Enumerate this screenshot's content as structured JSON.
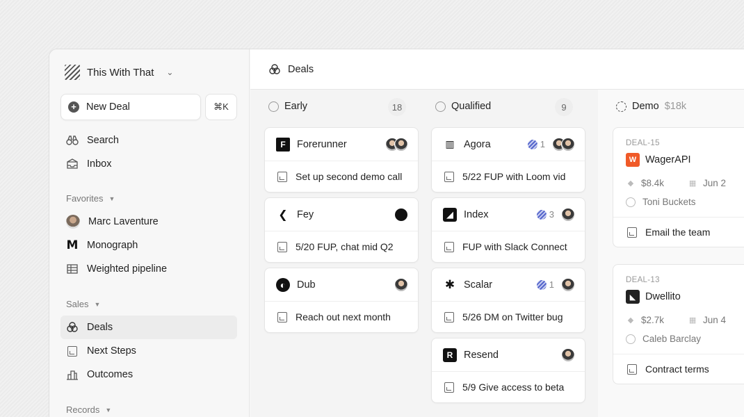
{
  "workspace": {
    "name": "This With That"
  },
  "sidebar": {
    "new_deal_label": "New Deal",
    "shortcut": "⌘K",
    "top_items": [
      {
        "label": "Search",
        "icon": "binoculars-icon"
      },
      {
        "label": "Inbox",
        "icon": "inbox-icon"
      }
    ],
    "favorites_header": "Favorites",
    "favorites": [
      {
        "label": "Marc Laventure",
        "icon": "avatar"
      },
      {
        "label": "Monograph",
        "icon": "monograph-logo-icon"
      },
      {
        "label": "Weighted pipeline",
        "icon": "table-icon"
      }
    ],
    "sales_header": "Sales",
    "sales": [
      {
        "label": "Deals",
        "icon": "deals-icon",
        "active": true
      },
      {
        "label": "Next Steps",
        "icon": "chart-doc-icon"
      },
      {
        "label": "Outcomes",
        "icon": "building-icon"
      }
    ],
    "records_header": "Records"
  },
  "topbar": {
    "title": "Deals"
  },
  "columns": [
    {
      "name": "Early",
      "count": "18",
      "cards": [
        {
          "company": "Forerunner",
          "task": "Set up second demo call",
          "logo_color": "#111111",
          "logo_char": "F"
        },
        {
          "company": "Fey",
          "task": "5/20 FUP, chat mid Q2",
          "logo_color": "#ffffff",
          "logo_char": "❮"
        },
        {
          "company": "Dub",
          "task": "Reach out next month",
          "logo_color": "#111111",
          "logo_char": "◐"
        }
      ]
    },
    {
      "name": "Qualified",
      "count": "9",
      "cards": [
        {
          "company": "Agora",
          "task": "5/22 FUP with Loom vid",
          "badge": "1",
          "logo_color": "#ffffff",
          "logo_char": "▥"
        },
        {
          "company": "Index",
          "task": "FUP with Slack Connect",
          "badge": "3",
          "logo_color": "#111111",
          "logo_char": "◢"
        },
        {
          "company": "Scalar",
          "task": "5/26 DM on Twitter bug",
          "badge": "1",
          "logo_color": "#ffffff",
          "logo_char": "✱"
        },
        {
          "company": "Resend",
          "task": "5/9 Give access to beta",
          "logo_color": "#111111",
          "logo_char": "R"
        }
      ]
    }
  ],
  "demo_column": {
    "name": "Demo",
    "amount": "$18k",
    "cards": [
      {
        "id": "DEAL-15",
        "company": "WagerAPI",
        "value": "$8.4k",
        "date": "Jun 2",
        "owner": "Toni Buckets",
        "task": "Email the team",
        "logo_color": "#f05a28"
      },
      {
        "id": "DEAL-13",
        "company": "Dwellito",
        "value": "$2.7k",
        "date": "Jun 4",
        "owner": "Caleb Barclay",
        "task": "Contract terms",
        "logo_color": "#222222"
      }
    ]
  },
  "colors": {
    "accent": "#5566cc",
    "wager": "#f05a28"
  }
}
